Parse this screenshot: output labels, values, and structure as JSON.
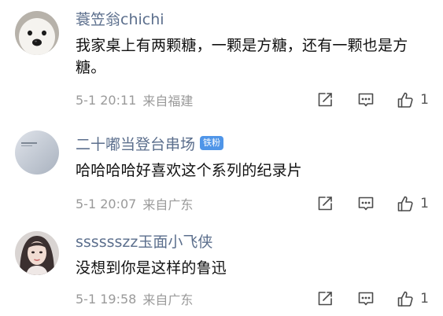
{
  "comments": [
    {
      "username": "蓑笠翁chichi",
      "badge": "",
      "text": "我家桌上有两颗糖，一颗是方糖，还有一颗也是方糖。",
      "timestamp": "5-1 20:11",
      "location": "来自福建",
      "likes": "1",
      "avatar_icon": "dog-face-avatar"
    },
    {
      "username": "二十嘟当登台串场",
      "badge": "铁粉",
      "text": "哈哈哈哈好喜欢这个系列的纪录片",
      "timestamp": "5-1 20:07",
      "location": "来自广东",
      "likes": "1",
      "avatar_icon": "gray-device-avatar"
    },
    {
      "username": "sssssszz玉面小飞侠",
      "badge": "",
      "text": "没想到你是这样的鲁迅",
      "timestamp": "5-1 19:58",
      "location": "来自广东",
      "likes": "1",
      "avatar_icon": "woman-portrait-avatar"
    }
  ],
  "icons": {
    "share": "share-icon",
    "reply": "comment-icon",
    "like": "thumbs-up-icon"
  },
  "colors": {
    "username": "#5c6f8d",
    "badge": "#4f95e8",
    "meta_text": "#9a9a9a",
    "icon_stroke": "#4a4a4a"
  }
}
